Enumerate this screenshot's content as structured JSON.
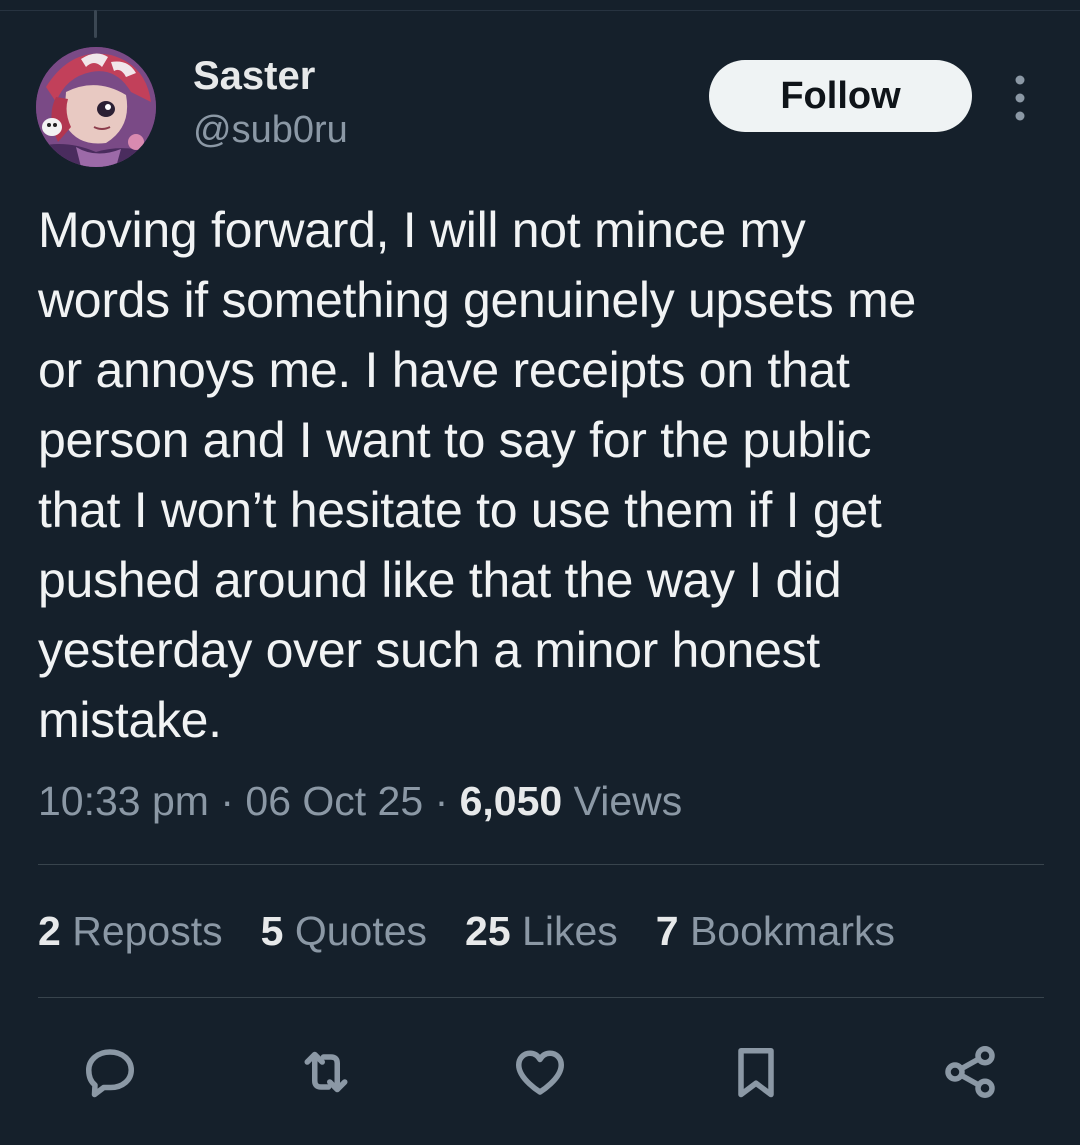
{
  "user": {
    "display_name": "Saster",
    "handle": "@sub0ru",
    "avatar_icon": "anime-avatar"
  },
  "follow_button": {
    "label": "Follow"
  },
  "more_icon": "more-vertical-icon",
  "tweet": {
    "lines": [
      "Moving forward, I will not mince my",
      "words if something genuinely upsets me",
      "or annoys me. I have receipts on that",
      "person and I want to say for the public",
      "that I won’t hesitate to use them if I get",
      "pushed around like that the way I did",
      "yesterday over such a minor honest",
      "mistake."
    ]
  },
  "meta": {
    "time": "10:33 pm",
    "separator": " · ",
    "date": "06 Oct 25",
    "views_count": "6,050",
    "views_label": " Views"
  },
  "stats": {
    "reposts": {
      "count": "2",
      "label": " Reposts"
    },
    "quotes": {
      "count": "5",
      "label": " Quotes"
    },
    "likes": {
      "count": "25",
      "label": " Likes"
    },
    "bookmarks": {
      "count": "7",
      "label": " Bookmarks"
    }
  },
  "actions": [
    "reply-icon",
    "repost-icon",
    "like-icon",
    "bookmark-icon",
    "share-icon"
  ],
  "colors": {
    "background": "#15202b",
    "text": "#e7e9ea",
    "secondary": "#8b98a5",
    "follow_bg": "#eff3f4",
    "divider": "#38444d"
  }
}
